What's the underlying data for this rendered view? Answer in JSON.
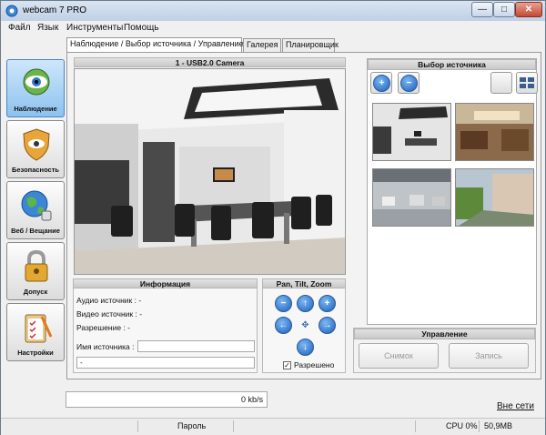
{
  "window": {
    "title": "webcam 7 PRO",
    "minimize_glyph": "—",
    "maximize_glyph": "□",
    "close_glyph": "✕"
  },
  "menu": [
    "Файл",
    "Язык",
    "Инструменты",
    "Помощь"
  ],
  "sidebar": [
    {
      "label": "Наблюдение",
      "icon": "eye-icon",
      "active": true
    },
    {
      "label": "Безопасность",
      "icon": "shield-icon",
      "active": false
    },
    {
      "label": "Веб / Вещание",
      "icon": "globe-icon",
      "active": false
    },
    {
      "label": "Допуск",
      "icon": "padlock-icon",
      "active": false
    },
    {
      "label": "Настройки",
      "icon": "clipboard-icon",
      "active": false
    }
  ],
  "tabs": [
    {
      "label": "Наблюдение / Выбор источника / Управление",
      "active": true
    },
    {
      "label": "Галерея",
      "active": false
    },
    {
      "label": "Планировщик",
      "active": false
    }
  ],
  "camera": {
    "title": "1 - USB2.0 Camera"
  },
  "info": {
    "title": "Информация",
    "audio": "Аудио источник : -",
    "video": "Видео источник : -",
    "resolution": "Разрешение : -",
    "source_name_label": "Имя источника :",
    "source_name_value": "",
    "extra_value": "-"
  },
  "ptz": {
    "title": "Pan, Tilt, Zoom",
    "enabled_label": "Разрешено",
    "enabled": true,
    "zoom_out_glyph": "−",
    "zoom_in_glyph": "+",
    "up_glyph": "↑",
    "down_glyph": "↓",
    "left_glyph": "←",
    "right_glyph": "→",
    "center_glyph": "✥"
  },
  "source_select": {
    "title": "Выбор источника",
    "add_glyph": "+",
    "remove_glyph": "−"
  },
  "control": {
    "title": "Управление",
    "snapshot": "Снимок",
    "record": "Запись"
  },
  "bandwidth": "0 kb/s",
  "offline": "Вне сети",
  "status": {
    "password": "Пароль",
    "cpu": "CPU 0%",
    "memory": "50,9MB"
  },
  "colors": {
    "accent": "#1b5fb8",
    "active_tab": "#8cc2ef"
  }
}
